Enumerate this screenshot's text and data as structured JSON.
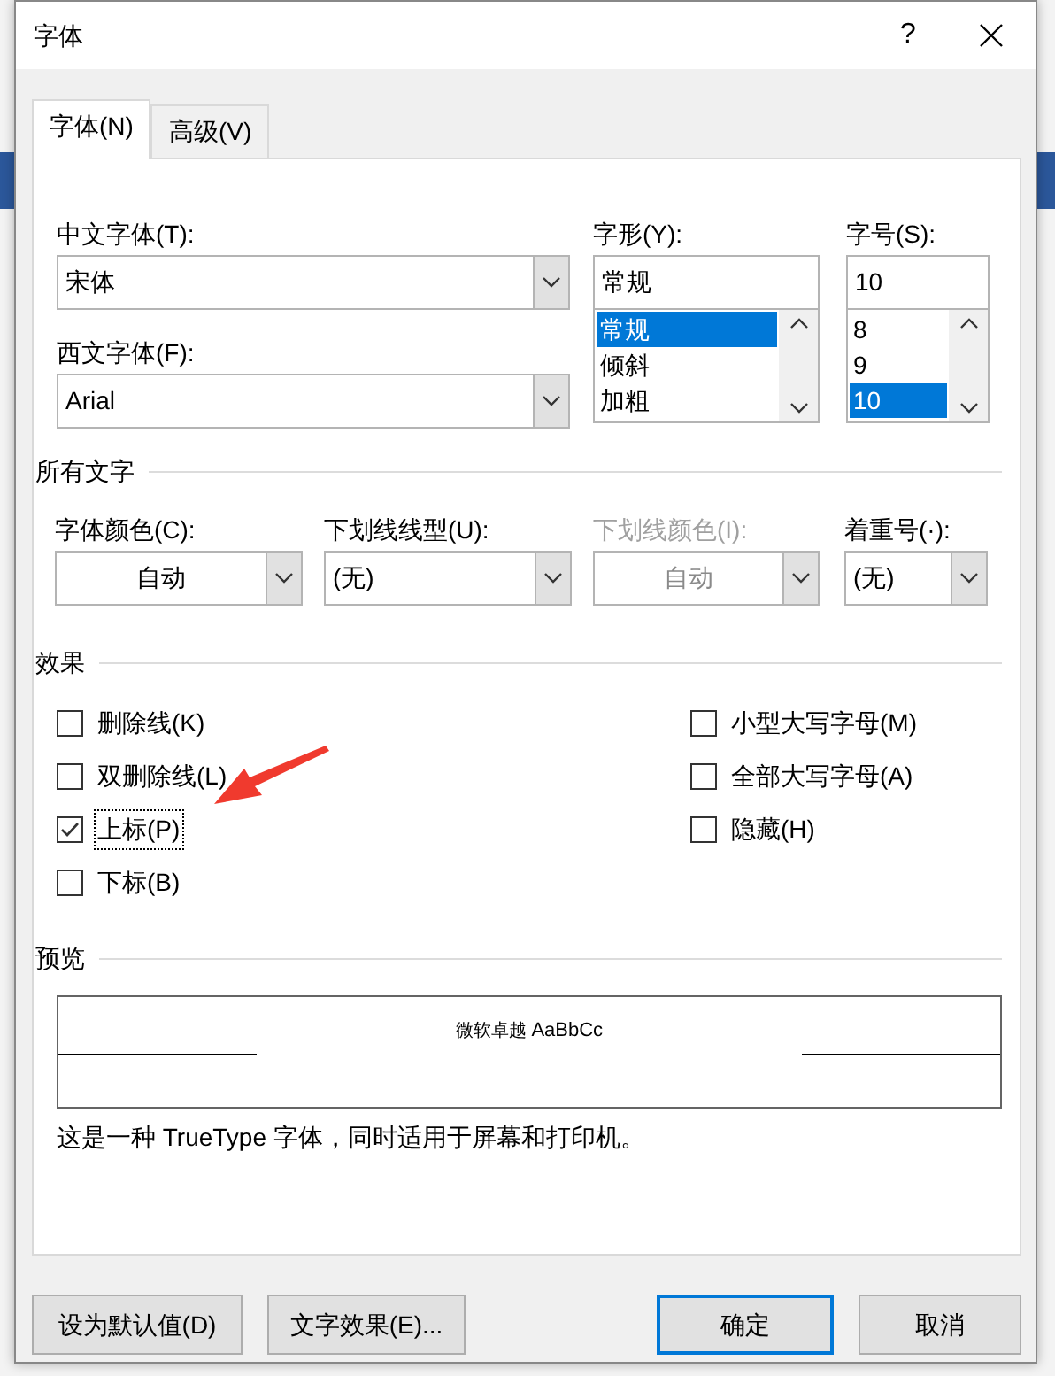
{
  "window": {
    "title": "字体",
    "help": "?"
  },
  "tabs": [
    {
      "label": "字体(N)",
      "selected": true
    },
    {
      "label": "高级(V)",
      "selected": false
    }
  ],
  "chinese_font": {
    "label": "中文字体(T):",
    "value": "宋体"
  },
  "western_font": {
    "label": "西文字体(F):",
    "value": "Arial"
  },
  "font_style": {
    "label": "字形(Y):",
    "value": "常规",
    "options": [
      {
        "label": "常规",
        "selected": true
      },
      {
        "label": "倾斜",
        "selected": false
      },
      {
        "label": "加粗",
        "selected": false
      }
    ]
  },
  "font_size": {
    "label": "字号(S):",
    "value": "10",
    "options": [
      {
        "label": "8",
        "selected": false
      },
      {
        "label": "9",
        "selected": false
      },
      {
        "label": "10",
        "selected": true
      }
    ]
  },
  "all_text": {
    "heading": "所有文字",
    "fields": [
      {
        "label": "字体颜色(C):",
        "value": "自动",
        "kind": "color",
        "disabled": false
      },
      {
        "label": "下划线线型(U):",
        "value": "(无)",
        "kind": "list",
        "disabled": false
      },
      {
        "label": "下划线颜色(I):",
        "value": "自动",
        "kind": "color",
        "disabled": true
      },
      {
        "label": "着重号(·):",
        "value": "(无)",
        "kind": "list",
        "disabled": false
      }
    ]
  },
  "effects": {
    "heading": "效果",
    "left": [
      {
        "label": "删除线(K)",
        "checked": false,
        "focused": false
      },
      {
        "label": "双删除线(L)",
        "checked": false,
        "focused": false
      },
      {
        "label": "上标(P)",
        "checked": true,
        "focused": true
      },
      {
        "label": "下标(B)",
        "checked": false,
        "focused": false
      }
    ],
    "right": [
      {
        "label": "小型大写字母(M)",
        "checked": false,
        "focused": false
      },
      {
        "label": "全部大写字母(A)",
        "checked": false,
        "focused": false
      },
      {
        "label": "隐藏(H)",
        "checked": false,
        "focused": false
      }
    ]
  },
  "preview": {
    "heading": "预览",
    "sample_cjk": "微软卓越",
    "sample_latin": "AaBbCc",
    "note": "这是一种 TrueType 字体，同时适用于屏幕和打印机。"
  },
  "buttons": [
    {
      "label": "设为默认值(D)",
      "default": false
    },
    {
      "label": "文字效果(E)...",
      "default": false
    },
    {
      "label": "确定",
      "default": true
    },
    {
      "label": "取消",
      "default": false
    }
  ]
}
